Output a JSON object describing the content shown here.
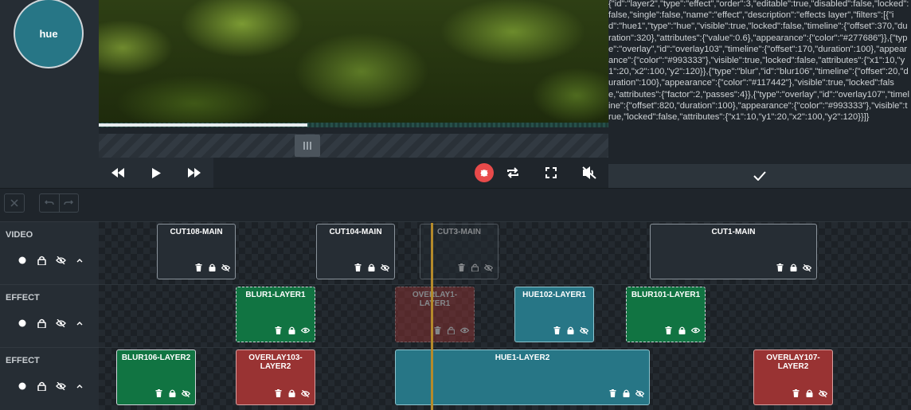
{
  "selected_filter": {
    "label": "hue",
    "color": "#277686"
  },
  "player": {
    "progress": 0.41,
    "buttons": [
      "rewind",
      "play",
      "fast-forward",
      "record",
      "loop",
      "fullscreen",
      "mute"
    ]
  },
  "json_editor": {
    "text": "{\"id\":\"layer2\",\"type\":\"effect\",\"order\":3,\"editable\":true,\"disabled\":false,\"locked\":false,\"single\":false,\"name\":\"effect\",\"description\":\"effects layer\",\"filters\":[{\"id\":\"hue1\",\"type\":\"hue\",\"visible\":true,\"locked\":false,\"timeline\":{\"offset\":370,\"duration\":320},\"attributes\":{\"value\":0.6},\"appearance\":{\"color\":\"#277686\"}},{\"type\":\"overlay\",\"id\":\"overlay103\",\"timeline\":{\"offset\":170,\"duration\":100},\"appearance\":{\"color\":\"#993333\"},\"visible\":true,\"locked\":false,\"attributes\":{\"x1\":10,\"y1\":20,\"x2\":100,\"y2\":120}},{\"type\":\"blur\",\"id\":\"blur106\",\"timeline\":{\"offset\":20,\"duration\":100},\"appearance\":{\"color\":\"#117442\"},\"visible\":true,\"locked\":false,\"attributes\":{\"factor\":2,\"passes\":4}},{\"type\":\"overlay\",\"id\":\"overlay107\",\"timeline\":{\"offset\":820,\"duration\":100},\"appearance\":{\"color\":\"#993333\"},\"visible\":true,\"locked\":false,\"attributes\":{\"x1\":10,\"y1\":20,\"x2\":100,\"y2\":120}}]}"
  },
  "tracks": [
    {
      "title": "VIDEO"
    },
    {
      "title": "EFFECT"
    },
    {
      "title": "EFFECT"
    }
  ],
  "clips": {
    "video": [
      "CUT108-MAIN",
      "CUT104-MAIN",
      "CUT3-MAIN",
      "CUT1-MAIN"
    ],
    "effect1": [
      "BLUR1-LAYER1",
      "OVERLAY1-LAYER1",
      "HUE102-LAYER1",
      "BLUR101-LAYER1"
    ],
    "effect2": [
      "BLUR106-LAYER2",
      "OVERLAY103-LAYER2",
      "HUE1-LAYER2",
      "OVERLAY107-LAYER2"
    ]
  },
  "colors": {
    "hue": "#277686",
    "overlay": "#993333",
    "blur": "#117442",
    "record": "#e84a4a",
    "playhead": "#b58a2a"
  }
}
